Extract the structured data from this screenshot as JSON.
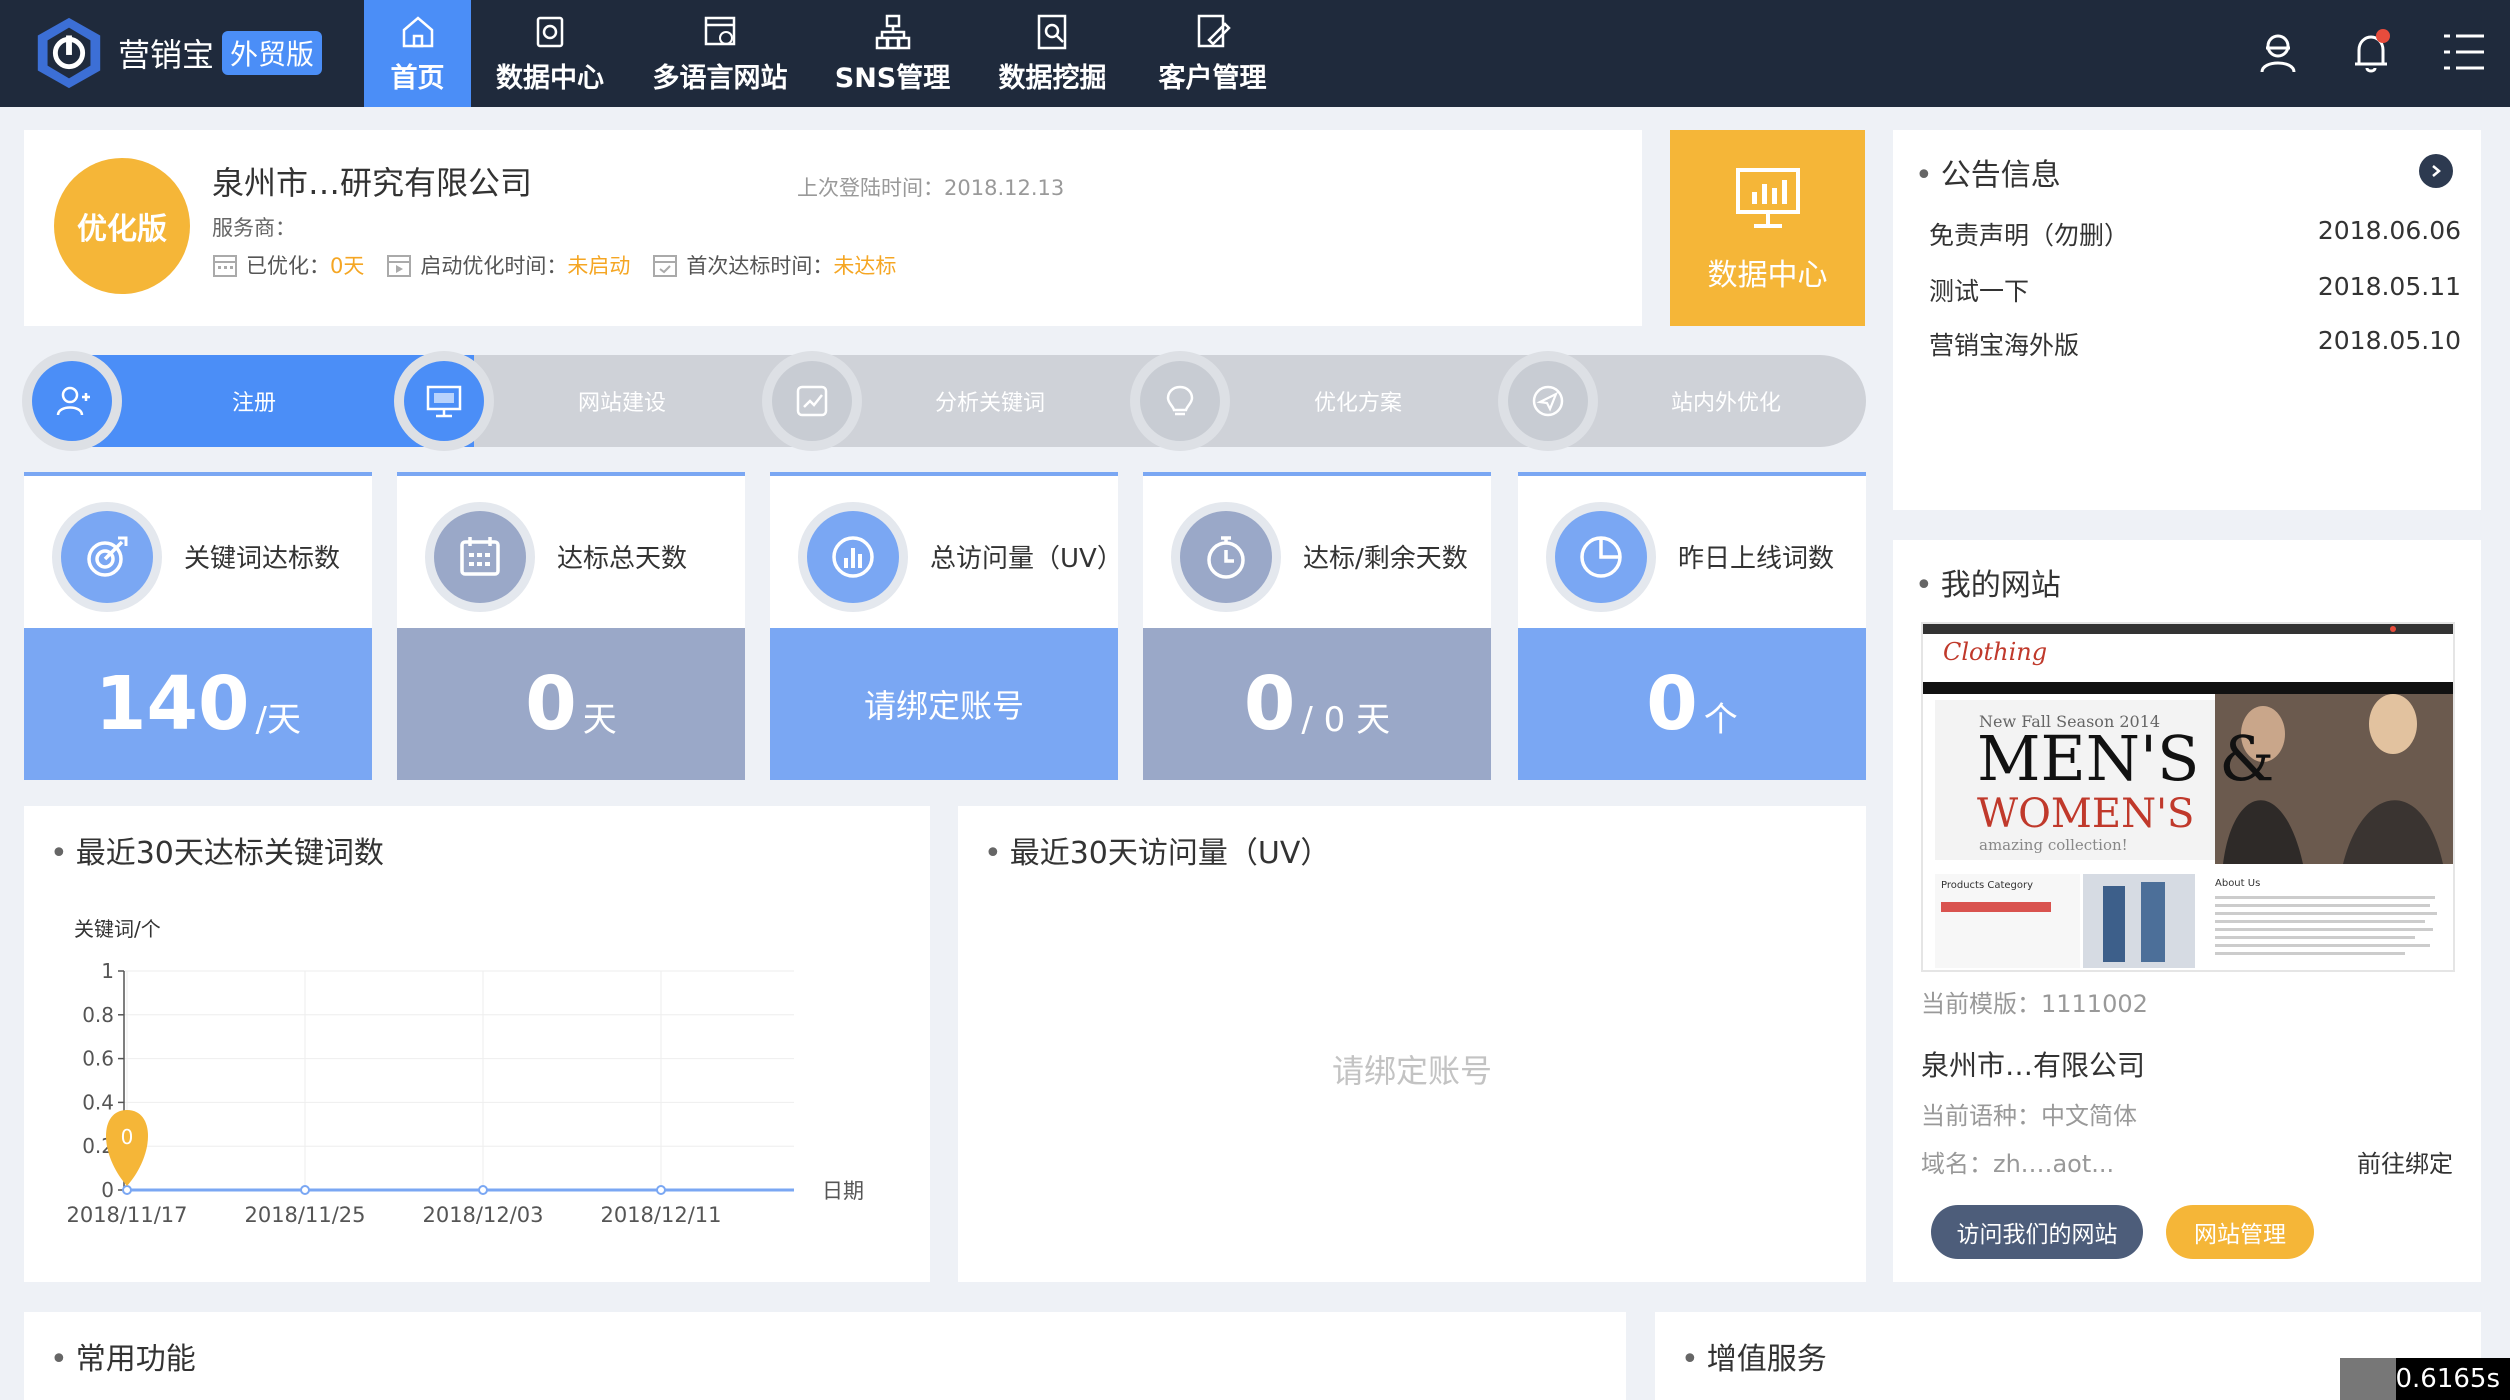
{
  "brand": {
    "name": "营销宝",
    "badge": "外贸版"
  },
  "nav": {
    "items": [
      {
        "label": "首页",
        "icon": "home-icon",
        "active": true
      },
      {
        "label": "数据中心",
        "icon": "data-center-icon"
      },
      {
        "label": "多语言网站",
        "icon": "multilingual-site-icon"
      },
      {
        "label": "SNS管理",
        "icon": "sns-icon"
      },
      {
        "label": "数据挖掘",
        "icon": "data-mining-icon"
      },
      {
        "label": "客户管理",
        "icon": "customer-icon"
      }
    ],
    "right_icons": [
      "user-support-icon",
      "bell-icon",
      "menu-icon"
    ],
    "accent": "#4b8ef7",
    "bg": "#1f2a3c"
  },
  "profile": {
    "badge": "优化版",
    "company_name": "泉州市…研究有限公司",
    "last_login_label": "上次登陆时间：",
    "last_login": "2018.12.13",
    "service_label": "服务商：",
    "optimized_label": "已优化：",
    "optimized_value": "0天",
    "start_label": "启动优化时间：",
    "start_value": "未启动",
    "first_label": "首次达标时间：",
    "first_value": "未达标"
  },
  "data_center_tile": {
    "label": "数据中心"
  },
  "steps": {
    "items": [
      {
        "label": "注册",
        "icon": "user-add-icon",
        "done": true
      },
      {
        "label": "网站建设",
        "icon": "monitor-icon",
        "done": true
      },
      {
        "label": "分析关键词",
        "icon": "chart-analyze-icon",
        "done": false
      },
      {
        "label": "优化方案",
        "icon": "lightbulb-icon",
        "done": false
      },
      {
        "label": "站内外优化",
        "icon": "send-icon",
        "done": false
      }
    ]
  },
  "stats": [
    {
      "label": "关键词达标数",
      "value": "140",
      "unit": "/天",
      "icon": "target-icon",
      "color": "#7aa7f3"
    },
    {
      "label": "达标总天数",
      "value": "0",
      "unit": "天",
      "icon": "calendar-icon",
      "color": "#9aa8c8"
    },
    {
      "label": "总访问量（UV）",
      "message": "请绑定账号",
      "icon": "bar-circle-icon",
      "color": "#7aa7f3"
    },
    {
      "label": "达标/剩余天数",
      "value": "0",
      "unit": "/ 0 天",
      "icon": "stopwatch-icon",
      "color": "#9aa8c8"
    },
    {
      "label": "昨日上线词数",
      "value": "0",
      "unit": "个",
      "icon": "pie-icon",
      "color": "#7aa7f3"
    }
  ],
  "keyword_chart": {
    "title": "最近30天达标关键词数",
    "chart_data": {
      "type": "line",
      "x": [
        "2018/11/17",
        "2018/11/25",
        "2018/12/03",
        "2018/12/11"
      ],
      "series": [
        {
          "values": [
            0,
            0,
            0,
            0
          ]
        }
      ],
      "ylabel": "关键词/个",
      "xlabel": "日期",
      "ylim": [
        0,
        1
      ],
      "yticks": [
        "0",
        "0.2",
        "0.4",
        "0.6",
        "0.8",
        "1"
      ],
      "marker_label": "0",
      "line_color": "#7aa7f3",
      "marker_color": "#f5b638",
      "grid": true
    }
  },
  "uv_chart": {
    "title": "最近30天访问量（UV）",
    "placeholder": "请绑定账号"
  },
  "notices": {
    "title": "公告信息",
    "items": [
      {
        "title": "免责声明（勿删）",
        "date": "2018.06.06"
      },
      {
        "title": "测试一下",
        "date": "2018.05.11"
      },
      {
        "title": "营销宝海外版",
        "date": "2018.05.10"
      }
    ]
  },
  "my_site": {
    "title": "我的网站",
    "template_label": "当前模版：",
    "template_value": "1111002",
    "site_name": "泉州市…有限公司",
    "language_label": "当前语种：",
    "language_value": "中文简体",
    "domain_label": "域名：",
    "domain_value": "zh.…aot...",
    "bind_link": "前往绑定",
    "visit_button": "访问我们的网站",
    "manage_button": "网站管理",
    "thumb": {
      "brand": "Clothing",
      "season": "New Fall Season 2014",
      "headline1": "MEN'S &",
      "headline2": "WOMEN'S",
      "tagline": "amazing collection!",
      "category": "Products Category",
      "about": "About Us"
    }
  },
  "common_functions": {
    "title": "常用功能"
  },
  "value_added": {
    "title": "增值服务"
  },
  "timer": "0.6165s"
}
